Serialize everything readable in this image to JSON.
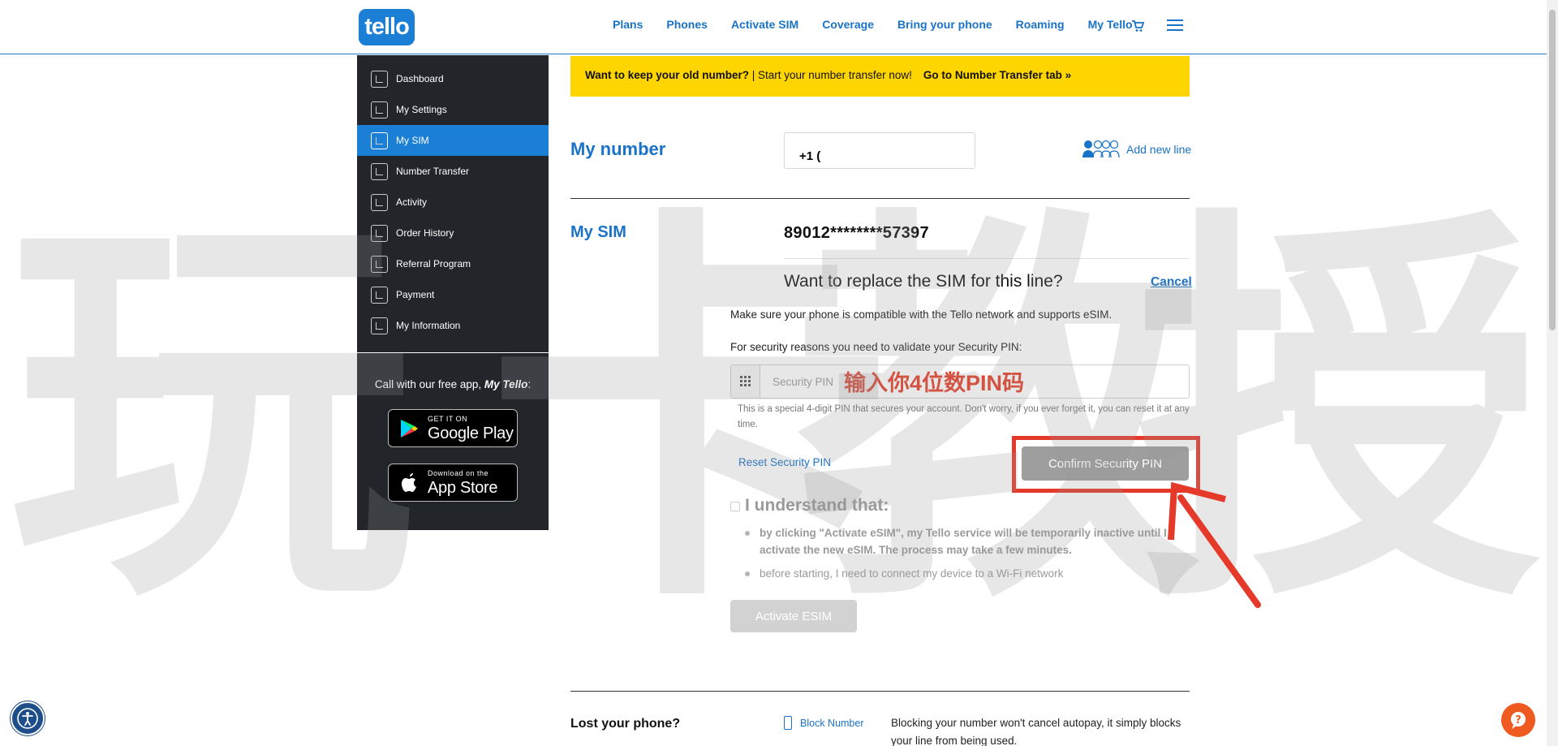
{
  "header": {
    "logo_text": "tello",
    "nav": [
      "Plans",
      "Phones",
      "Activate SIM",
      "Coverage",
      "Bring your phone",
      "Roaming",
      "My Tello"
    ],
    "cart_icon": "cart-icon",
    "menu_icon": "hamburger-menu-icon"
  },
  "sidebar": {
    "items": [
      {
        "label": "Dashboard",
        "icon": "dashboard-icon"
      },
      {
        "label": "My Settings",
        "icon": "settings-icon"
      },
      {
        "label": "My SIM",
        "icon": "sim-icon",
        "active": true
      },
      {
        "label": "Number Transfer",
        "icon": "number-transfer-icon"
      },
      {
        "label": "Activity",
        "icon": "activity-icon"
      },
      {
        "label": "Order History",
        "icon": "order-history-icon"
      },
      {
        "label": "Referral Program",
        "icon": "referral-icon"
      },
      {
        "label": "Payment",
        "icon": "payment-icon"
      },
      {
        "label": "My Information",
        "icon": "user-icon"
      }
    ],
    "app_text_prefix": "Call with our free app, ",
    "app_text_brand": "My Tello",
    "app_text_suffix": ":",
    "google_play": {
      "small": "GET IT ON",
      "big": "Google Play"
    },
    "app_store": {
      "small": "Download on the",
      "big": "App Store"
    }
  },
  "banner": {
    "question": "Want to keep your old number?",
    "separator": " | ",
    "text": "Start your number transfer now!",
    "link": "Go to Number Transfer tab »"
  },
  "my_number": {
    "label": "My number",
    "value": "+1 (",
    "add_line": "Add new line"
  },
  "my_sim": {
    "label": "My SIM",
    "iccid": "89012********57397",
    "replace_question": "Want to replace the SIM for this line?",
    "cancel": "Cancel",
    "compat_text": "Make sure your phone is compatible with the Tello network and supports eSIM.",
    "security_text": "For security reasons you need to validate your Security PIN:",
    "pin_placeholder": "Security PIN",
    "pin_help": "This is a special 4-digit PIN that secures your account. Don't worry, if you ever forget it, you can reset it at any time.",
    "reset_pin": "Reset Security PIN",
    "confirm_pin": "Confirm Security PIN",
    "understand_title": "I understand that:",
    "bullet1": "by clicking \"Activate eSIM\", my Tello service will be temporarily inactive until I activate the new eSIM. The process may take a few minutes.",
    "bullet2": "before starting, I need to connect my device to a Wi-Fi network",
    "activate_esim": "Activate ESIM"
  },
  "annotation": {
    "text": "输入你4位数PIN码",
    "color": "#e5392a"
  },
  "watermark": {
    "chars": [
      "玩",
      "卡",
      "教",
      "授"
    ]
  },
  "lost_phone": {
    "label": "Lost your phone?",
    "block_number": "Block Number",
    "desc": "Blocking your number won't cancel autopay, it simply blocks your line from being used."
  },
  "colors": {
    "brand_blue": "#1c7fd6",
    "banner_yellow": "#ffd500",
    "sidebar_dark": "#22262b",
    "help_orange": "#ee5a20"
  }
}
